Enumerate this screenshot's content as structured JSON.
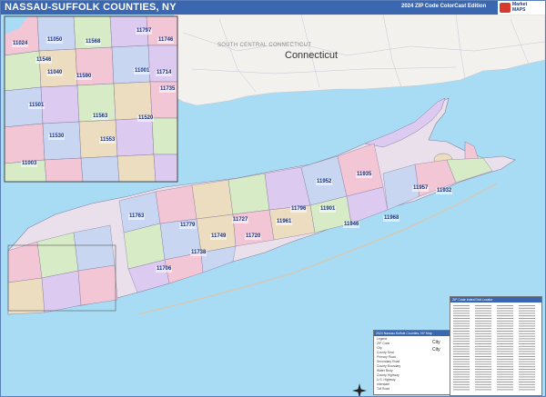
{
  "header": {
    "title": "NASSAU-SUFFOLK COUNTIES, NY",
    "edition": "2024 ZIP Code ColorCast Edition",
    "logo_text_1": "Market",
    "logo_text_2": "MAPS"
  },
  "map": {
    "region_label": "SOUTH CENTRAL CONNECTICUT",
    "state_label": "Connecticut",
    "colors": {
      "water": "#a8dcf5",
      "land_ct": "#f2f1ee",
      "zip_pink": "#f3c6d6",
      "zip_blue": "#c9d6f2",
      "zip_tan": "#ecdcc0",
      "zip_green": "#d7ecc6",
      "zip_purple": "#dccaf0"
    },
    "inset_zips": [
      "11024",
      "11050",
      "11568",
      "11797",
      "11746",
      "11546",
      "11040",
      "11001",
      "11714",
      "11590",
      "11735",
      "11501",
      "11563",
      "11520",
      "11553",
      "11003",
      "11530"
    ],
    "main_zips": [
      "11935",
      "11952",
      "11957",
      "11901",
      "11932",
      "11946",
      "11968",
      "11961",
      "11763",
      "11779",
      "11749",
      "11796",
      "11706",
      "11720",
      "11727",
      "11738"
    ]
  },
  "legend": {
    "title": "2024 Nassau-Suffolk Counties, NY Map",
    "rows": [
      "Legend",
      "ZIP Code",
      "City",
      "County Seat",
      "Primary Road",
      "Secondary Road",
      "County Boundary",
      "Water Body",
      "County Highway",
      "U.S. Highway",
      "Interstate",
      "Toll Road"
    ],
    "city_label": "City"
  },
  "index": {
    "title": "ZIP Code Index/Grid Locator"
  }
}
